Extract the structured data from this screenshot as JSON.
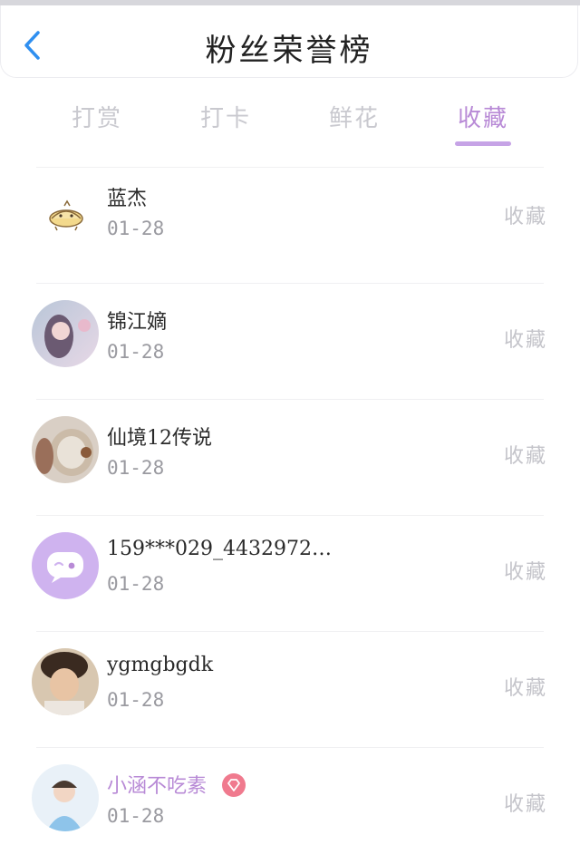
{
  "header": {
    "title": "粉丝荣誉榜"
  },
  "tabs": [
    {
      "label": "打赏",
      "active": false
    },
    {
      "label": "打卡",
      "active": false
    },
    {
      "label": "鲜花",
      "active": false
    },
    {
      "label": "收藏",
      "active": true
    }
  ],
  "rows": [
    {
      "name": "蓝杰",
      "date": "01-28",
      "action": "收藏",
      "avatar": "bun-icon"
    },
    {
      "name": "锦江嫡",
      "date": "01-28",
      "action": "收藏",
      "avatar": "photo"
    },
    {
      "name": "仙境12传说",
      "date": "01-28",
      "action": "收藏",
      "avatar": "shell-photo"
    },
    {
      "name": "159***029_4432972…",
      "date": "01-28",
      "action": "收藏",
      "avatar": "chat-bubble-icon"
    },
    {
      "name": "ygmgbgdk",
      "date": "01-28",
      "action": "收藏",
      "avatar": "photo"
    },
    {
      "name": "小涵不吃素",
      "date": "01-28",
      "action": "收藏",
      "avatar": "photo",
      "vip": true
    }
  ],
  "colors": {
    "accent": "#b88ad6",
    "tab_inactive": "#c9c9cf",
    "action_text": "#c4c4ca",
    "date_text": "#9a9aa0",
    "vip_badge": "#f07a8e",
    "chat_avatar_bg": "#cfb3ef"
  }
}
